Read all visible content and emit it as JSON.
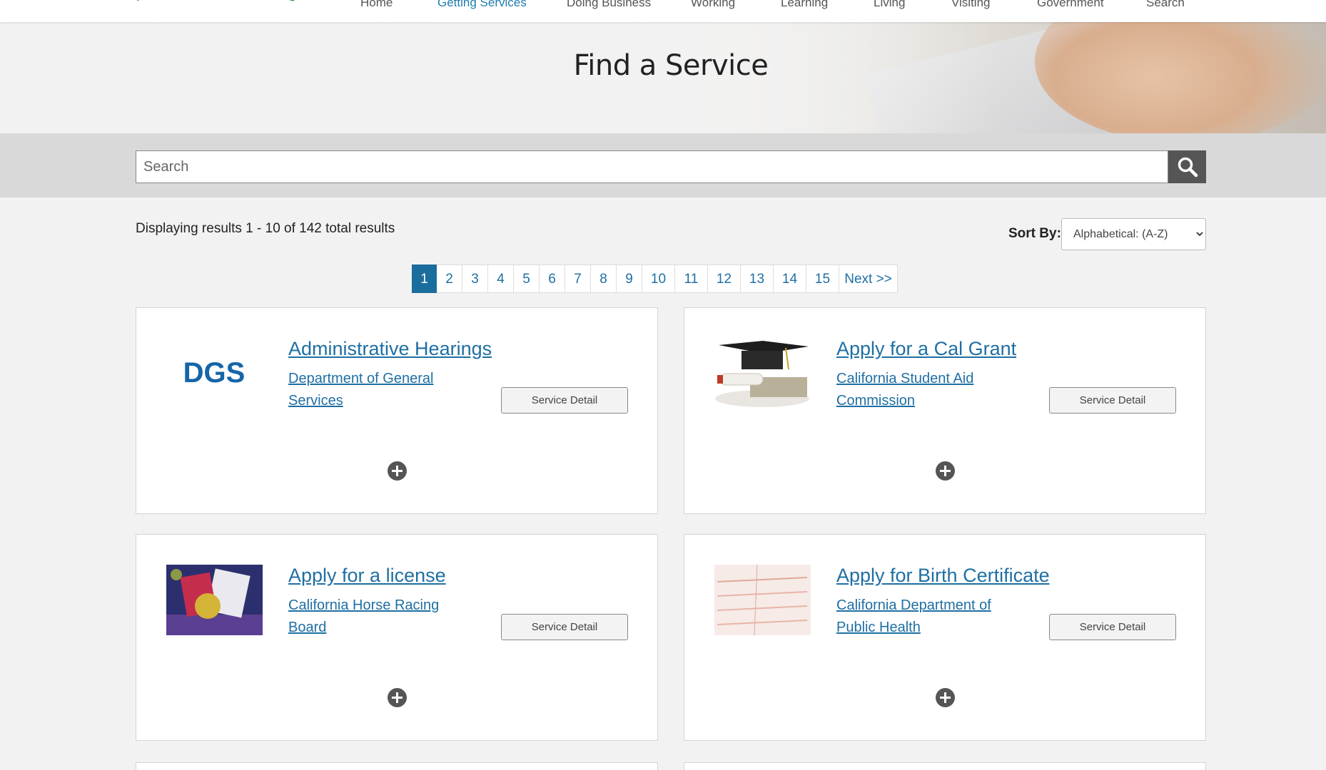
{
  "nav": {
    "items": [
      {
        "label": "Home",
        "active": false
      },
      {
        "label": "Getting Services",
        "active": true
      },
      {
        "label": "Doing Business",
        "active": false
      },
      {
        "label": "Working",
        "active": false
      },
      {
        "label": "Learning",
        "active": false
      },
      {
        "label": "Living",
        "active": false
      },
      {
        "label": "Visiting",
        "active": false
      },
      {
        "label": "Government",
        "active": false
      },
      {
        "label": "Search",
        "active": false
      }
    ]
  },
  "hero": {
    "title": "Find a Service"
  },
  "search": {
    "placeholder": "Search"
  },
  "results": {
    "summary": "Displaying results 1 - 10 of 142 total results"
  },
  "sort": {
    "label": "Sort By:",
    "selected": "Alphabetical: (A-Z)"
  },
  "pagination": {
    "pages": [
      "1",
      "2",
      "3",
      "4",
      "5",
      "6",
      "7",
      "8",
      "9",
      "10",
      "11",
      "12",
      "13",
      "14",
      "15"
    ],
    "current": "1",
    "next_label": "Next >>"
  },
  "services": [
    {
      "title": "Administrative Hearings",
      "agency": "Department of General Services",
      "button": "Service Detail",
      "image": "dgs-logo",
      "logo_text": "DGS"
    },
    {
      "title": "Apply for a Cal Grant",
      "agency": "California Student Aid Commission",
      "button": "Service Detail",
      "image": "graduation-cap-photo"
    },
    {
      "title": "Apply for a license",
      "agency": "California Horse Racing Board",
      "button": "Service Detail",
      "image": "license-photo"
    },
    {
      "title": "Apply for Birth Certificate",
      "agency": "California Department of Public Health",
      "button": "Service Detail",
      "image": "birth-certificate-photo"
    }
  ],
  "colors": {
    "link": "#1f6fa3",
    "active_page": "#1a6d9d",
    "nav_active": "#1f7cae",
    "search_button": "#555555"
  }
}
